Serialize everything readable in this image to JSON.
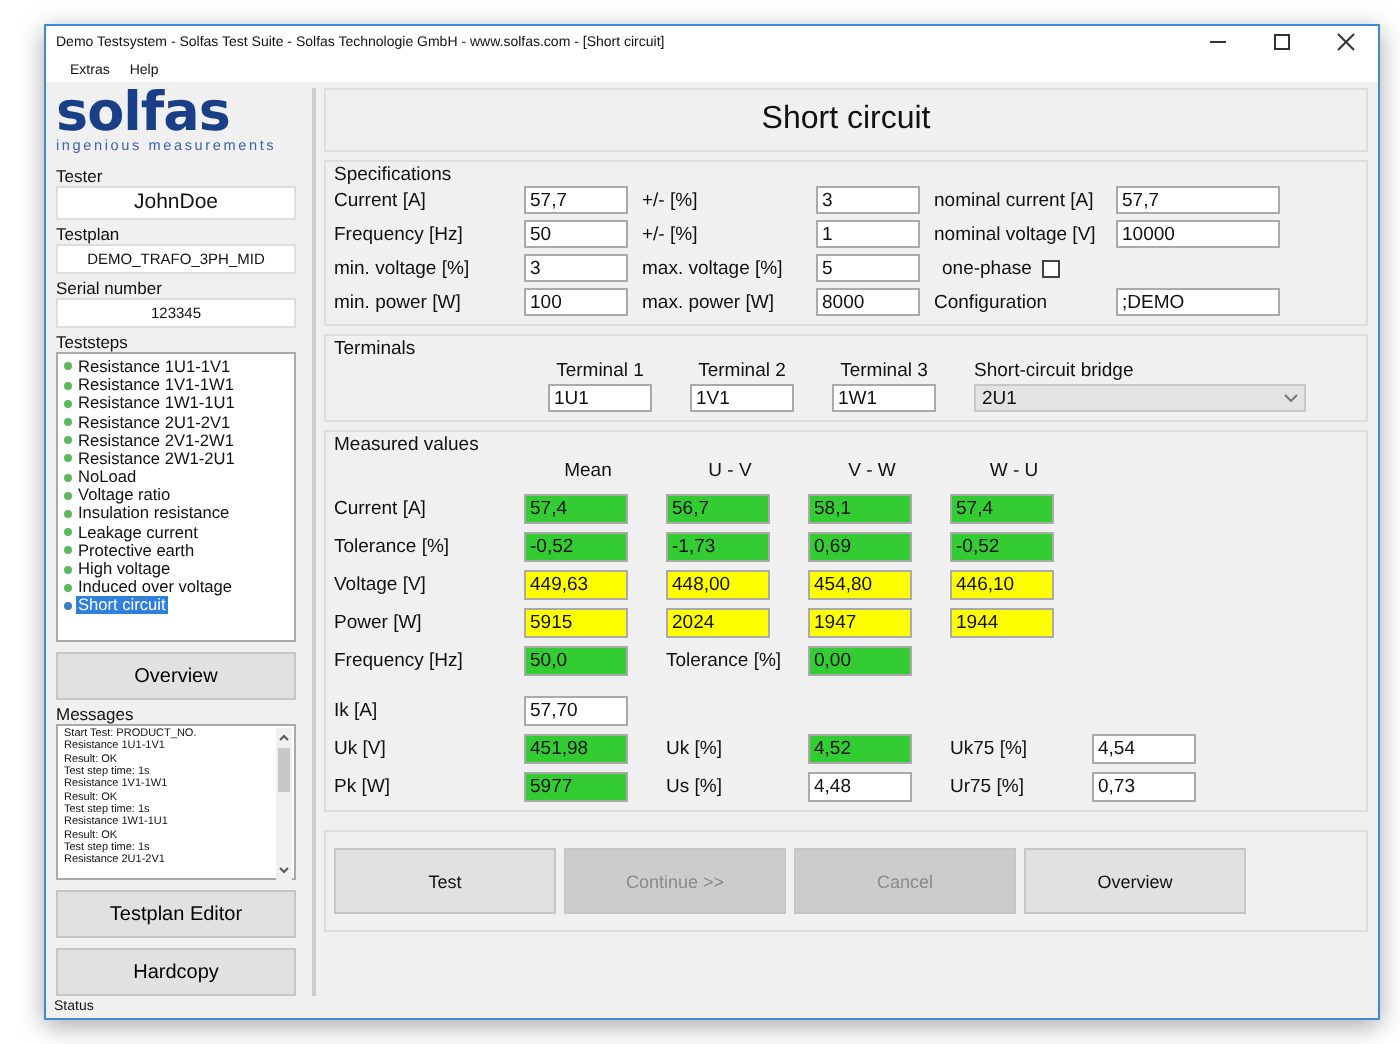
{
  "window": {
    "title": "Demo Testsystem - Solfas Test Suite - Solfas Technologie GmbH - www.solfas.com - [Short circuit]"
  },
  "menu": [
    "Extras",
    "Help"
  ],
  "logo": {
    "name": "solfas",
    "tagline": "ingenious measurements"
  },
  "sidebar": {
    "tester": {
      "label": "Tester",
      "value": "JohnDoe"
    },
    "testplan": {
      "label": "Testplan",
      "value": "DEMO_TRAFO_3PH_MID"
    },
    "serial": {
      "label": "Serial number",
      "value": "123345"
    },
    "teststeps": {
      "label": "Teststeps",
      "items": [
        {
          "label": "Resistance 1U1-1V1",
          "color": "#5cb85c",
          "selected": false
        },
        {
          "label": "Resistance 1V1-1W1",
          "color": "#5cb85c",
          "selected": false
        },
        {
          "label": "Resistance 1W1-1U1",
          "color": "#5cb85c",
          "selected": false
        },
        {
          "label": "Resistance 2U1-2V1",
          "color": "#5cb85c",
          "selected": false
        },
        {
          "label": "Resistance 2V1-2W1",
          "color": "#5cb85c",
          "selected": false
        },
        {
          "label": "Resistance 2W1-2U1",
          "color": "#5cb85c",
          "selected": false
        },
        {
          "label": "NoLoad",
          "color": "#5cb85c",
          "selected": false
        },
        {
          "label": "Voltage ratio",
          "color": "#5cb85c",
          "selected": false
        },
        {
          "label": "Insulation resistance",
          "color": "#5cb85c",
          "selected": false
        },
        {
          "label": "Leakage current",
          "color": "#5cb85c",
          "selected": false
        },
        {
          "label": "Protective earth",
          "color": "#5cb85c",
          "selected": false
        },
        {
          "label": "High voltage",
          "color": "#5cb85c",
          "selected": false
        },
        {
          "label": "Induced over voltage",
          "color": "#5cb85c",
          "selected": false
        },
        {
          "label": "Short circuit",
          "color": "#3d7fc4",
          "selected": true
        }
      ]
    },
    "overview_button": "Overview",
    "messages": {
      "label": "Messages",
      "lines": [
        "Start Test: PRODUCT_NO.",
        "Resistance 1U1-1V1",
        "Result: OK",
        "Test step time: 1s",
        "Resistance 1V1-1W1",
        "Result: OK",
        "Test step time: 1s",
        "Resistance 1W1-1U1",
        "Result: OK",
        "Test step time: 1s",
        "Resistance 2U1-2V1"
      ]
    },
    "buttons": [
      "Testplan Editor",
      "Hardcopy"
    ]
  },
  "main": {
    "title": "Short circuit",
    "specifications": {
      "title": "Specifications",
      "rows": [
        [
          {
            "kind": "label",
            "text": "Current [A]"
          },
          {
            "kind": "field",
            "text": "57,7"
          },
          {
            "kind": "label",
            "text": "+/- [%]"
          },
          {
            "kind": "field",
            "text": "3"
          },
          {
            "kind": "label",
            "text": "nominal current [A]"
          },
          {
            "kind": "field",
            "text": "57,7"
          }
        ],
        [
          {
            "kind": "label",
            "text": "Frequency [Hz]"
          },
          {
            "kind": "field",
            "text": "50"
          },
          {
            "kind": "label",
            "text": "+/- [%]"
          },
          {
            "kind": "field",
            "text": "1"
          },
          {
            "kind": "label",
            "text": "nominal voltage [V]"
          },
          {
            "kind": "field",
            "text": "10000"
          }
        ],
        [
          {
            "kind": "label",
            "text": "min. voltage [%]"
          },
          {
            "kind": "field",
            "text": "3"
          },
          {
            "kind": "label",
            "text": "max. voltage [%]"
          },
          {
            "kind": "field",
            "text": "5"
          },
          {
            "kind": "checkbox",
            "text": "one-phase",
            "checked": false
          }
        ],
        [
          {
            "kind": "label",
            "text": "min. power [W]"
          },
          {
            "kind": "field",
            "text": "100"
          },
          {
            "kind": "label",
            "text": "max. power [W]"
          },
          {
            "kind": "field",
            "text": "8000"
          },
          {
            "kind": "label",
            "text": "Configuration"
          },
          {
            "kind": "field",
            "text": ";DEMO"
          }
        ]
      ]
    },
    "terminals": {
      "title": "Terminals",
      "columns": [
        {
          "kind": "field",
          "label": "Terminal 1",
          "value": "1U1"
        },
        {
          "kind": "field",
          "label": "Terminal 2",
          "value": "1V1"
        },
        {
          "kind": "field",
          "label": "Terminal 3",
          "value": "1W1"
        },
        {
          "kind": "dropdown",
          "label": "Short-circuit bridge",
          "value": "2U1"
        }
      ]
    },
    "measured": {
      "title": "Measured values",
      "headers": [
        "Mean",
        "U - V",
        "V - W",
        "W - U"
      ],
      "rows": [
        [
          {
            "kind": "label",
            "text": "Current [A]"
          },
          {
            "kind": "value",
            "text": "57,4",
            "color": "#33cc33"
          },
          {
            "kind": "value",
            "text": "56,7",
            "color": "#33cc33"
          },
          {
            "kind": "value",
            "text": "58,1",
            "color": "#33cc33"
          },
          {
            "kind": "value",
            "text": "57,4",
            "color": "#33cc33"
          }
        ],
        [
          {
            "kind": "label",
            "text": "Tolerance [%]"
          },
          {
            "kind": "value",
            "text": "-0,52",
            "color": "#33cc33"
          },
          {
            "kind": "value",
            "text": "-1,73",
            "color": "#33cc33"
          },
          {
            "kind": "value",
            "text": "0,69",
            "color": "#33cc33"
          },
          {
            "kind": "value",
            "text": "-0,52",
            "color": "#33cc33"
          }
        ],
        [
          {
            "kind": "label",
            "text": "Voltage [V]"
          },
          {
            "kind": "value",
            "text": "449,63",
            "color": "#ffff00"
          },
          {
            "kind": "value",
            "text": "448,00",
            "color": "#ffff00"
          },
          {
            "kind": "value",
            "text": "454,80",
            "color": "#ffff00"
          },
          {
            "kind": "value",
            "text": "446,10",
            "color": "#ffff00"
          }
        ],
        [
          {
            "kind": "label",
            "text": "Power [W]"
          },
          {
            "kind": "value",
            "text": "5915",
            "color": "#ffff00"
          },
          {
            "kind": "value",
            "text": "2024",
            "color": "#ffff00"
          },
          {
            "kind": "value",
            "text": "1947",
            "color": "#ffff00"
          },
          {
            "kind": "value",
            "text": "1944",
            "color": "#ffff00"
          }
        ],
        [
          {
            "kind": "label",
            "text": "Frequency [Hz]"
          },
          {
            "kind": "value",
            "text": "50,0",
            "color": "#33cc33"
          },
          {
            "kind": "label",
            "text": "Tolerance [%]"
          },
          {
            "kind": "value",
            "text": "0,00",
            "color": "#33cc33"
          }
        ]
      ],
      "results": [
        [
          {
            "kind": "label",
            "text": "Ik [A]"
          },
          {
            "kind": "value",
            "text": "57,70",
            "color": "#ffffff"
          }
        ],
        [
          {
            "kind": "label",
            "text": "Uk [V]"
          },
          {
            "kind": "value",
            "text": "451,98",
            "color": "#33cc33"
          },
          {
            "kind": "label",
            "text": "Uk [%]"
          },
          {
            "kind": "value",
            "text": "4,52",
            "color": "#33cc33"
          },
          {
            "kind": "label",
            "text": "Uk75 [%]"
          },
          {
            "kind": "value",
            "text": "4,54",
            "color": "#ffffff"
          }
        ],
        [
          {
            "kind": "label",
            "text": "Pk [W]"
          },
          {
            "kind": "value",
            "text": "5977",
            "color": "#33cc33"
          },
          {
            "kind": "label",
            "text": "Us [%]"
          },
          {
            "kind": "value",
            "text": "4,48",
            "color": "#ffffff"
          },
          {
            "kind": "label",
            "text": "Ur75 [%]"
          },
          {
            "kind": "value",
            "text": "0,73",
            "color": "#ffffff"
          }
        ]
      ]
    },
    "actions": [
      {
        "label": "Test",
        "disabled": false
      },
      {
        "label": "Continue >>",
        "disabled": true
      },
      {
        "label": "Cancel",
        "disabled": true
      },
      {
        "label": "Overview",
        "disabled": false
      }
    ]
  },
  "status_bar": "Status"
}
